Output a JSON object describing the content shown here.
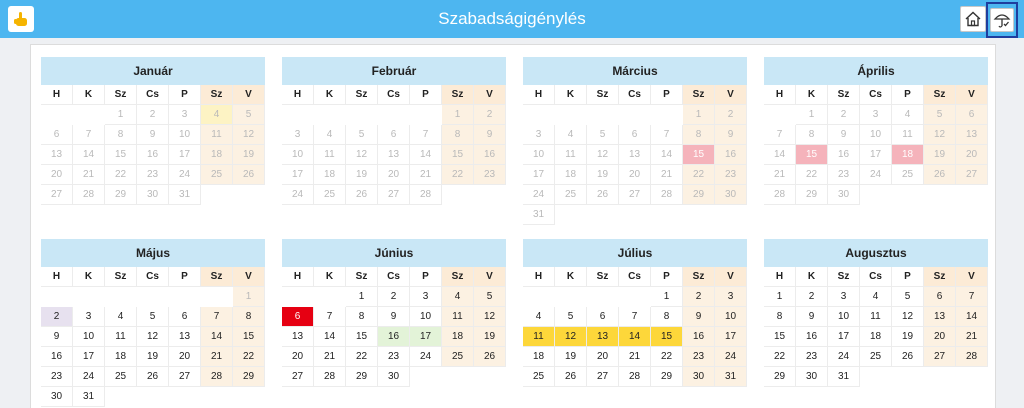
{
  "app": {
    "title": "Szabadságigénylés"
  },
  "icons": {
    "menu": "pointing-hand-icon",
    "home": "home-icon",
    "vacation": "beach-umbrella-icon"
  },
  "weekdays": [
    "H",
    "K",
    "Sz",
    "Cs",
    "P",
    "Sz",
    "V"
  ],
  "colors": {
    "topbar": "#4db6f0",
    "month_header": "#c9e7f6",
    "weekend": "#fcf1e2",
    "today": "#fdf3c4",
    "holiday": "#f5b3bb",
    "sick_day": "#e60012",
    "approved_vacation": "#fdd73a",
    "pending": "#e3f3d8",
    "selected": "#e7e1ef"
  },
  "months": [
    {
      "name": "Január",
      "offset": 2,
      "days": 31,
      "past_until": 31,
      "marks": {
        "4": "today"
      }
    },
    {
      "name": "Február",
      "offset": 5,
      "days": 28,
      "past_until": 28,
      "marks": {}
    },
    {
      "name": "Március",
      "offset": 5,
      "days": 31,
      "past_until": 31,
      "marks": {
        "15": "hol"
      }
    },
    {
      "name": "Április",
      "offset": 1,
      "days": 30,
      "past_until": 30,
      "marks": {
        "15": "hol",
        "18": "hol"
      }
    },
    {
      "name": "Május",
      "offset": 6,
      "days": 31,
      "past_until": 1,
      "marks": {
        "2": "sel"
      }
    },
    {
      "name": "Június",
      "offset": 2,
      "days": 30,
      "past_until": 0,
      "marks": {
        "6": "sick",
        "16": "lg",
        "17": "lg"
      }
    },
    {
      "name": "Július",
      "offset": 4,
      "days": 31,
      "past_until": 0,
      "marks": {
        "11": "gold",
        "12": "gold",
        "13": "gold",
        "14": "gold",
        "15": "gold"
      }
    },
    {
      "name": "Augusztus",
      "offset": 0,
      "days": 31,
      "past_until": 0,
      "marks": {}
    }
  ]
}
